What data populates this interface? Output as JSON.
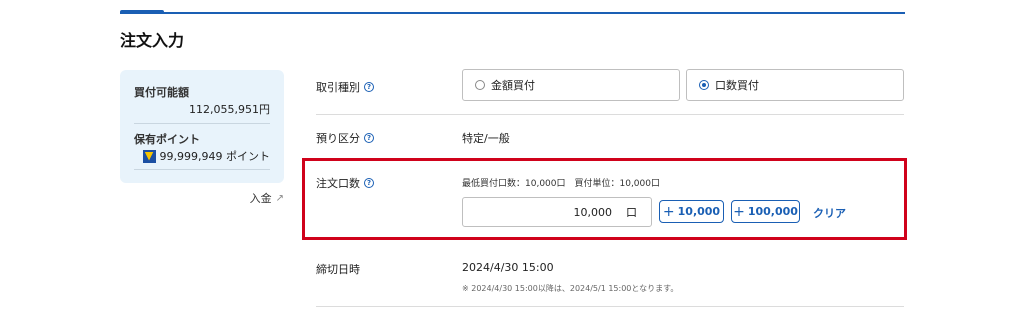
{
  "page_title": "注文入力",
  "balance": {
    "buying_power_label": "買付可能額",
    "buying_power_value": "112,055,951円",
    "points_label": "保有ポイント",
    "points_value": "99,999,949 ポイント",
    "points_icon": "t-point-icon"
  },
  "deposit_link": "入金",
  "rows": {
    "trade_type": {
      "label": "取引種別",
      "options": [
        {
          "label": "金額買付",
          "checked": false
        },
        {
          "label": "口数買付",
          "checked": true
        }
      ]
    },
    "account": {
      "label": "預り区分",
      "value": "特定/一般"
    },
    "quantity": {
      "label": "注文口数",
      "note": "最低買付口数：10,000口　買付単位：10,000口",
      "input_value": "10,000",
      "unit": "口",
      "add_buttons": [
        "10,000",
        "100,000"
      ],
      "clear_label": "クリア"
    },
    "deadline": {
      "label": "締切日時",
      "value": "2024/4/30 15:00",
      "note": "※ 2024/4/30 15:00以降は、2024/5/1 15:00となります。"
    }
  },
  "colors": {
    "accent": "#1a5fb4",
    "highlight": "#d0021b",
    "balance_bg": "#e8f3fb"
  }
}
